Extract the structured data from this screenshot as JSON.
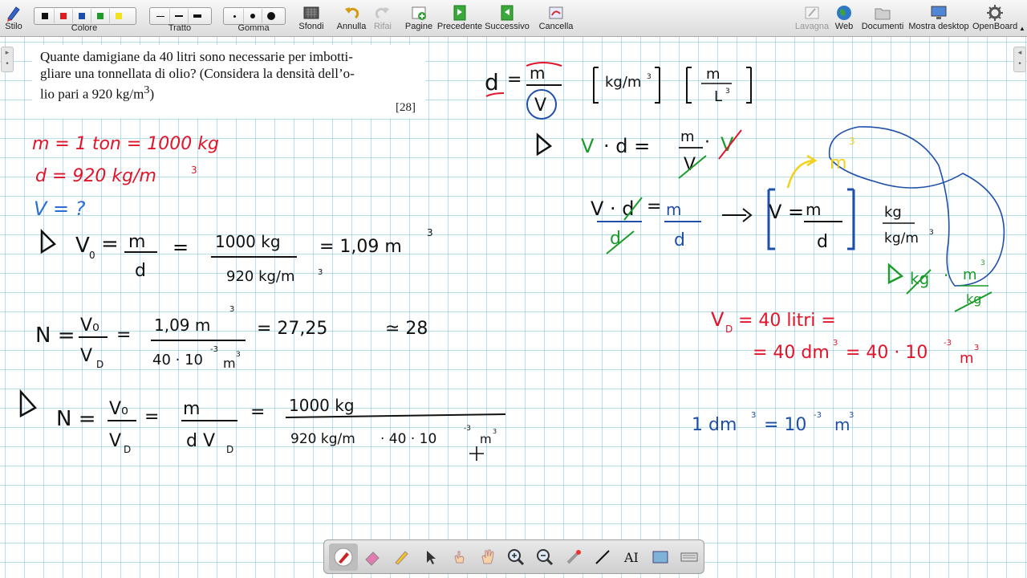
{
  "toolbar": {
    "stylus": "Stilo",
    "color_label": "Colore",
    "colors": [
      "#111111",
      "#e01b1b",
      "#1f4fa8",
      "#1f9b2a",
      "#f2e11b"
    ],
    "stroke_label": "Tratto",
    "eraser_label": "Gomma",
    "backgrounds": "Sfondi",
    "undo": "Annulla",
    "redo": "Rifai",
    "pages": "Pagine",
    "previous": "Precedente",
    "next": "Successivo",
    "clear": "Cancella",
    "board": "Lavagna",
    "web": "Web",
    "documents": "Documenti",
    "show_desktop": "Mostra desktop",
    "app": "OpenBoard"
  },
  "problem": {
    "line1": "Quante damigiane da 40 litri sono necessarie per imbotti-",
    "line2": "gliare una tonnellata di olio? (Considera la densità dell’o-",
    "line3_pre": "lio pari a 920 kg/m",
    "line3_sup": "3",
    "line3_post": ")",
    "ref": "[28]"
  },
  "handwriting": {
    "m_given": "m = 1 ton = 1000 kg",
    "d_given": "d = 920 kg/m",
    "v_unknown": "V = ?",
    "v0_lhs": "V",
    "v0_num": "m",
    "v0_den": "d",
    "v0_num2": "1000 kg",
    "v0_den2": "920 kg/m",
    "v0_result": "= 1,09 m",
    "n_lhs": "N =",
    "n_num": "V₀",
    "n_den": "V",
    "n_num2": "1,09 m",
    "n_den2": "40 · 10",
    "n_result": "= 27,25",
    "n_approx": "≃ 28",
    "n2_num": "V₀",
    "n2_den": "V",
    "n2_num2": "m",
    "n2_den2": "d V",
    "n2_num3": "1000 kg",
    "n2_den3": "920 kg/m",
    "n2_den3b": "· 40 · 10",
    "d_formula_num": "m",
    "d_formula_den": "V",
    "unit1": "kg/m",
    "unit2_num": "m",
    "unit2_den": "L",
    "step1": "V · d =",
    "step1_frac_num": "m",
    "step1_frac_den": "V",
    "step2_lhs": "V · d",
    "step2_den": "d",
    "step2_num": "m",
    "step2_den2": "d",
    "boxed_lhs": "V =",
    "boxed_num": "m",
    "boxed_den": "d",
    "unit_frac_num": "kg",
    "unit_frac_den": "kg/m",
    "m3_note": "m",
    "green_num": "m",
    "green_den": "kg",
    "vd_def": "V",
    "vd_val": "= 40 litri =",
    "vd_val2": "= 40 dm",
    "vd_val3": "= 40 · 10",
    "conv": "1 dm",
    "conv2": "= 10",
    "conv3": "m"
  },
  "dock": [
    "pen",
    "eraser",
    "marker",
    "select",
    "interact",
    "hand",
    "zoom-in",
    "zoom-out",
    "laser",
    "line",
    "text",
    "capture",
    "keyboard"
  ]
}
